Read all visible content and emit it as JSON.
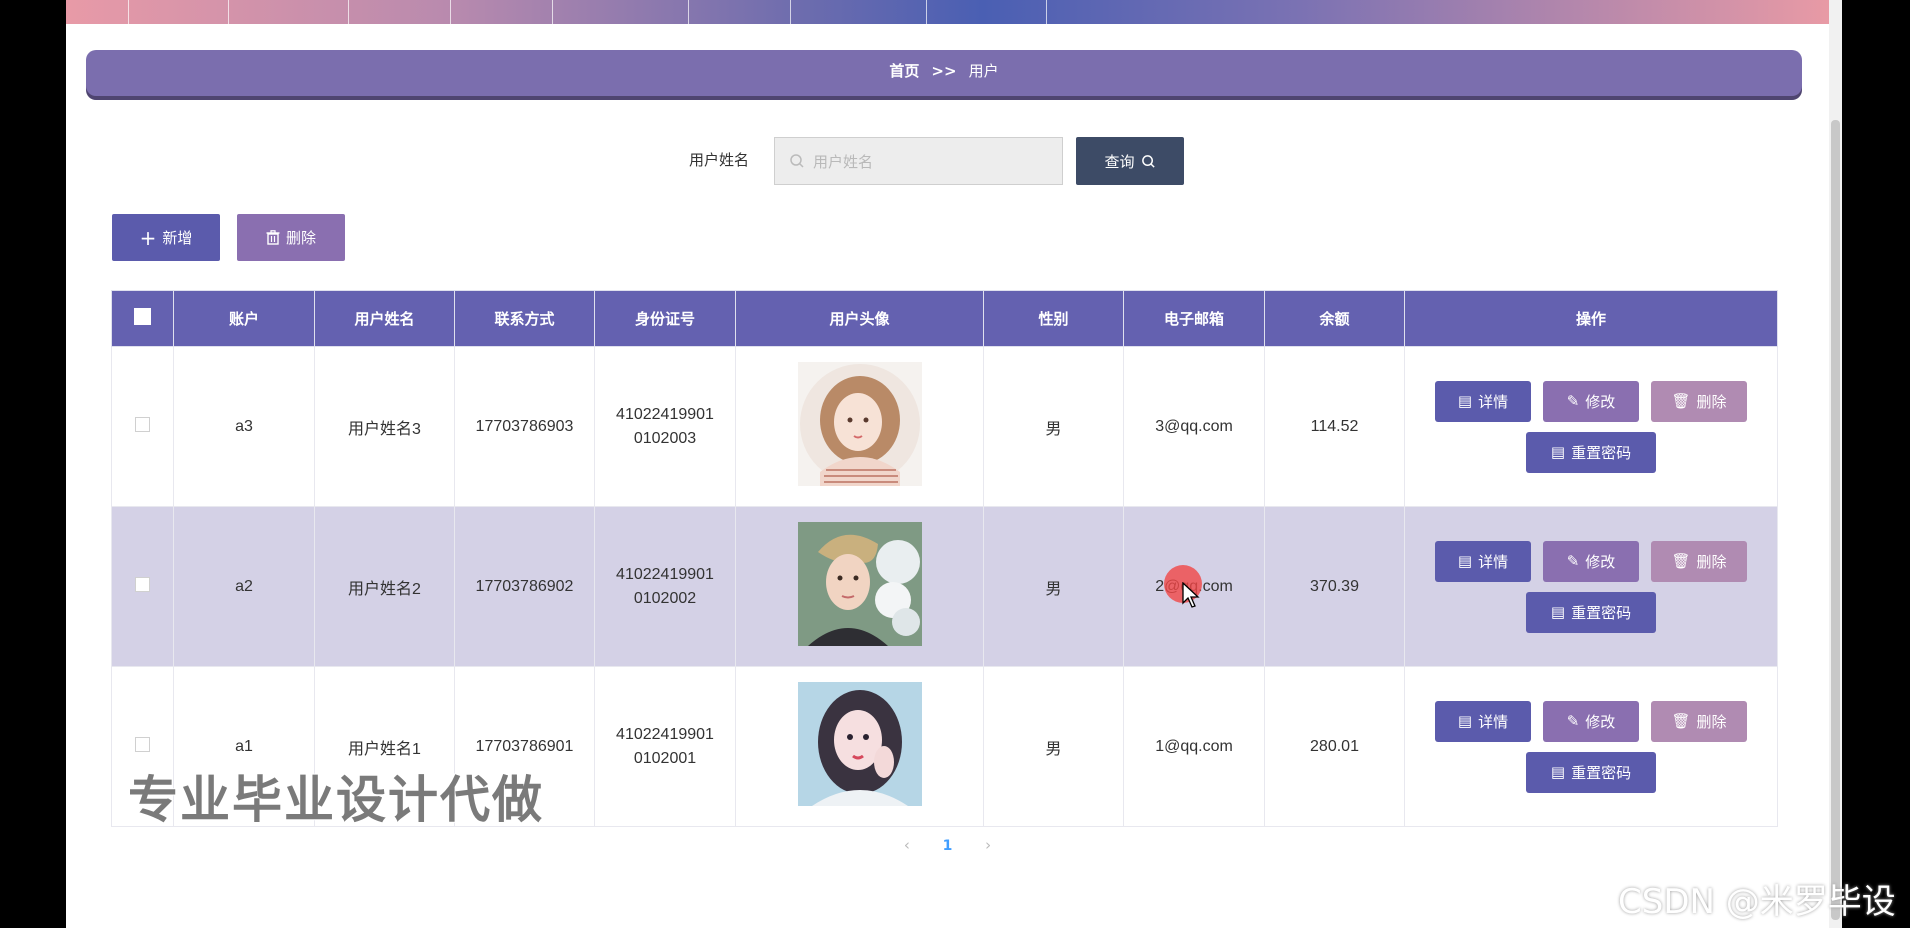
{
  "breadcrumb": {
    "home": "首页",
    "sep": ">>",
    "current": "用户"
  },
  "search": {
    "label": "用户姓名",
    "placeholder": "用户姓名",
    "value": "",
    "query_label": "查询"
  },
  "toolbar": {
    "add_label": "新增",
    "delete_label": "删除"
  },
  "table": {
    "headers": [
      "账户",
      "用户姓名",
      "联系方式",
      "身份证号",
      "用户头像",
      "性别",
      "电子邮箱",
      "余额",
      "操作"
    ],
    "rows": [
      {
        "account": "a3",
        "name": "用户姓名3",
        "phone": "17703786903",
        "id1": "41022419901",
        "id2": "0102003",
        "gender": "男",
        "email": "3@qq.com",
        "balance": "114.52",
        "avatar": "avatar-girl-1"
      },
      {
        "account": "a2",
        "name": "用户姓名2",
        "phone": "17703786902",
        "id1": "41022419901",
        "id2": "0102002",
        "gender": "男",
        "email": "2@qq.com",
        "balance": "370.39",
        "avatar": "avatar-boy"
      },
      {
        "account": "a1",
        "name": "用户姓名1",
        "phone": "17703786901",
        "id1": "41022419901",
        "id2": "0102001",
        "gender": "男",
        "email": "1@qq.com",
        "balance": "280.01",
        "avatar": "avatar-girl-2"
      }
    ],
    "actions": {
      "detail": "详情",
      "edit": "修改",
      "delete": "删除",
      "reset": "重置密码"
    }
  },
  "pagination": {
    "prev": "‹",
    "current": "1",
    "next": "›"
  },
  "overlay": {
    "watermark": "专业毕业设计代做",
    "csdn": "CSDN @米罗毕设"
  },
  "colors": {
    "header": "#6461b0",
    "primary": "#5b5bac",
    "edit": "#8a6fb0",
    "delete": "#b08bb2",
    "query": "#3d4b66",
    "breadcrumb": "#7b6eae"
  }
}
